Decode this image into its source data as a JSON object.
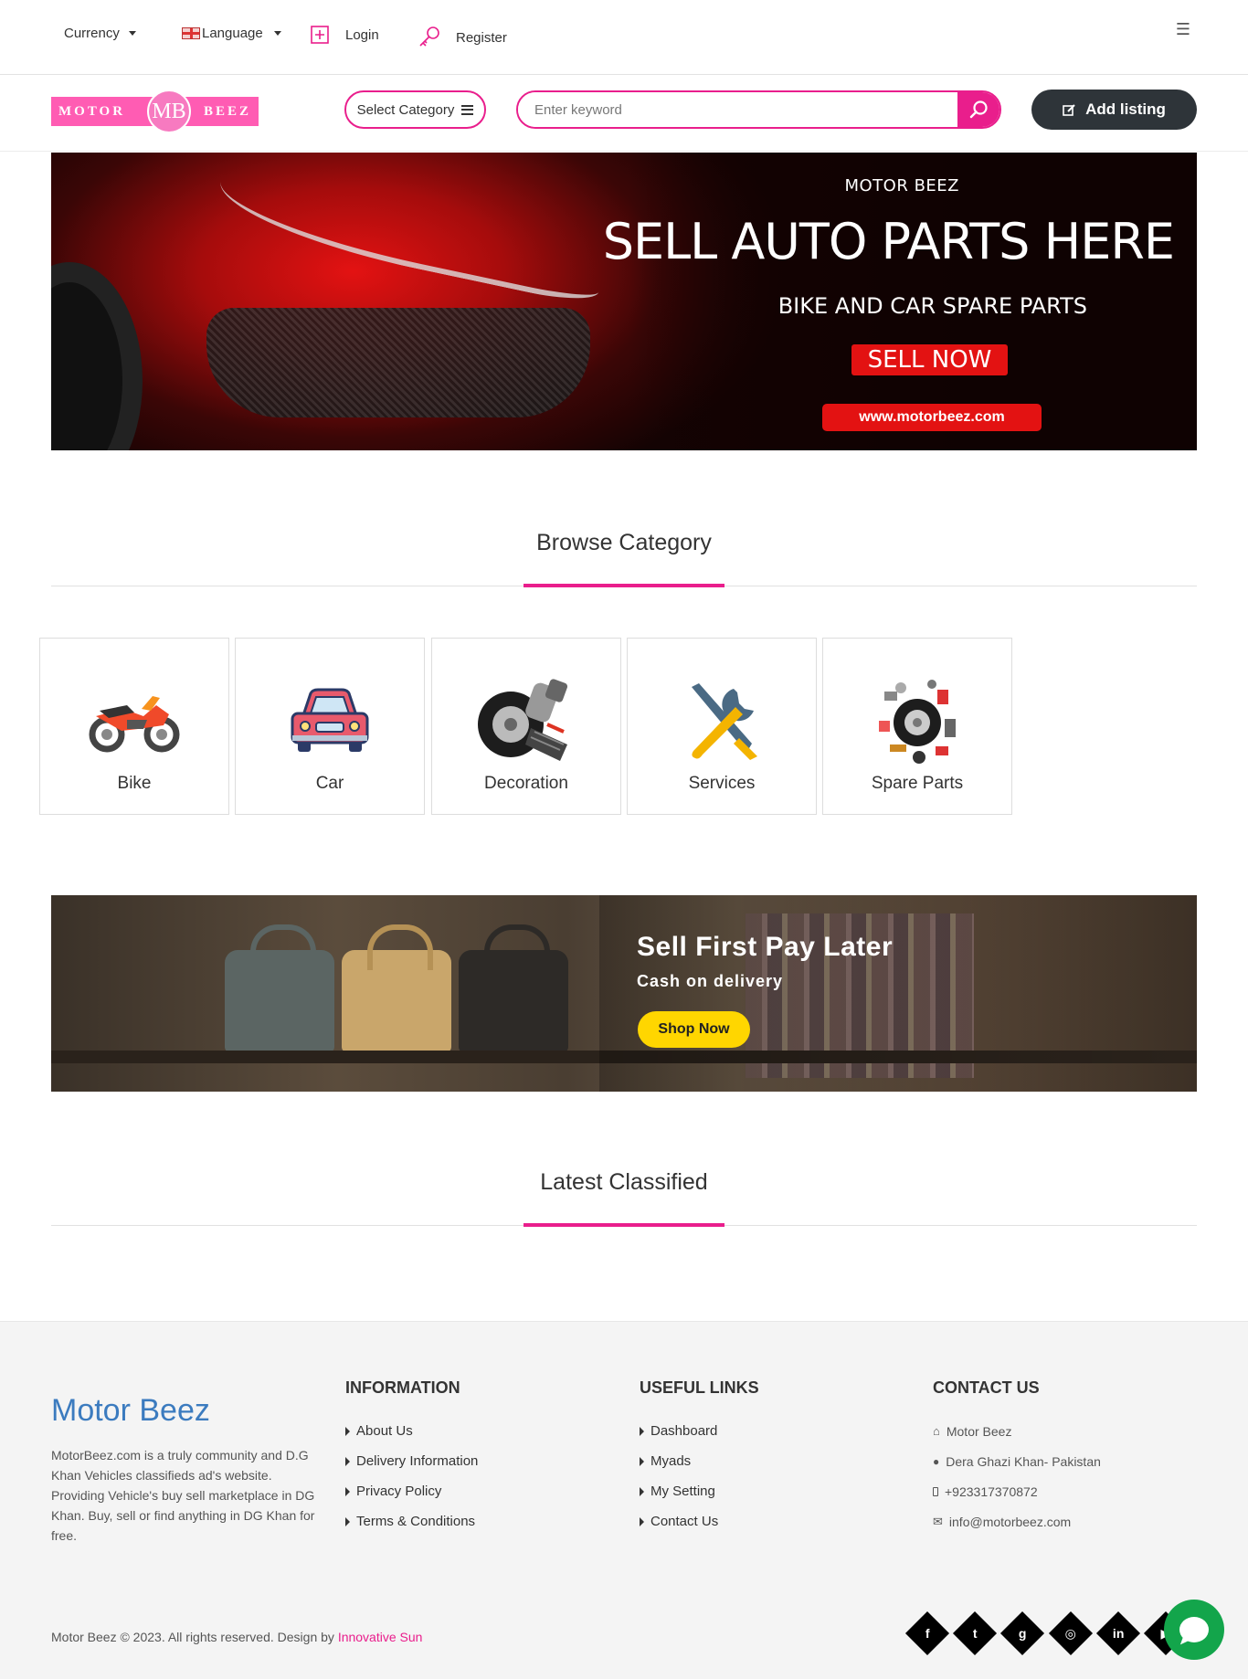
{
  "topbar": {
    "currency_label": "Currency",
    "language_label": "Language",
    "login_label": "Login",
    "register_label": "Register"
  },
  "header": {
    "logo_left": "MOTOR",
    "logo_mid": "MB",
    "logo_right": "BEEZ",
    "select_category_label": "Select Category",
    "search_placeholder": "Enter keyword",
    "add_listing_label": "Add listing"
  },
  "hero": {
    "brand": "MOTOR BEEZ",
    "headline": "SELL AUTO PARTS HERE",
    "subheadline": "BIKE AND CAR SPARE PARTS",
    "cta": "SELL NOW",
    "url": "www.motorbeez.com"
  },
  "browse": {
    "title": "Browse Category",
    "categories": [
      {
        "label": "Bike",
        "icon": "motorbike-icon"
      },
      {
        "label": "Car",
        "icon": "car-icon"
      },
      {
        "label": "Decoration",
        "icon": "wheel-exhaust-icon"
      },
      {
        "label": "Services",
        "icon": "tools-icon"
      },
      {
        "label": "Spare Parts",
        "icon": "spare-parts-icon"
      }
    ]
  },
  "promo": {
    "headline": "Sell First Pay Later",
    "sub": "Cash on delivery",
    "cta": "Shop Now"
  },
  "latest": {
    "title": "Latest Classified"
  },
  "footer": {
    "brand": "Motor Beez",
    "about": "MotorBeez.com is a truly community and D.G Khan Vehicles classifieds ad's website. Providing Vehicle's buy sell marketplace in DG Khan. Buy, sell or find anything in DG Khan for free.",
    "information": {
      "title": "INFORMATION",
      "links": [
        "About Us",
        "Delivery Information",
        "Privacy Policy",
        "Terms & Conditions"
      ]
    },
    "useful": {
      "title": "USEFUL LINKS",
      "links": [
        "Dashboard",
        "Myads",
        "My Setting",
        "Contact Us"
      ]
    },
    "contact": {
      "title": "CONTACT US",
      "name": "Motor Beez",
      "address": "Dera Ghazi Khan- Pakistan",
      "phone": "+923317370872",
      "email": "info@motorbeez.com"
    },
    "copyright": "Motor Beez © 2023. All rights reserved. Design by",
    "credit": "Innovative Sun",
    "social": [
      "facebook-icon",
      "twitter-icon",
      "google-plus-icon",
      "instagram-icon",
      "linkedin-icon",
      "youtube-icon"
    ]
  },
  "colors": {
    "accent": "#e91e8c",
    "dark": "#2e3439",
    "brand_blue": "#3b7bbf",
    "whatsapp": "#13a54b"
  }
}
